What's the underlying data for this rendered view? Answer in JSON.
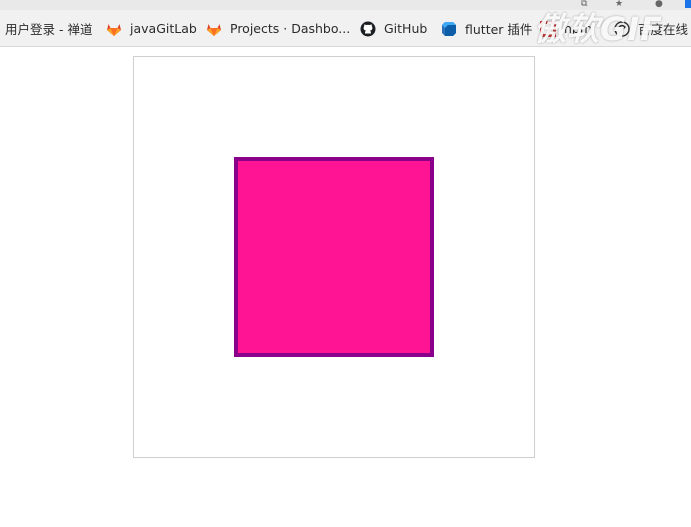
{
  "bookmarks_bar": {
    "items": [
      {
        "label": "用户登录 - 禅道",
        "icon": "none"
      },
      {
        "label": "javaGitLab",
        "icon": "gitlab-icon"
      },
      {
        "label": "Projects · Dashbo...",
        "icon": "gitlab-icon"
      },
      {
        "label": "GitHub",
        "icon": "github-icon"
      },
      {
        "label": "flutter 插件",
        "icon": "dart-icon"
      },
      {
        "label": "npm",
        "icon": "npm-icon"
      },
      {
        "label": "百度在线",
        "icon": "app-icon"
      }
    ]
  },
  "watermark": {
    "text": "傲软GIF"
  },
  "stage": {
    "square": {
      "fill_color": "#ff1493",
      "border_color": "#8b008b"
    }
  }
}
